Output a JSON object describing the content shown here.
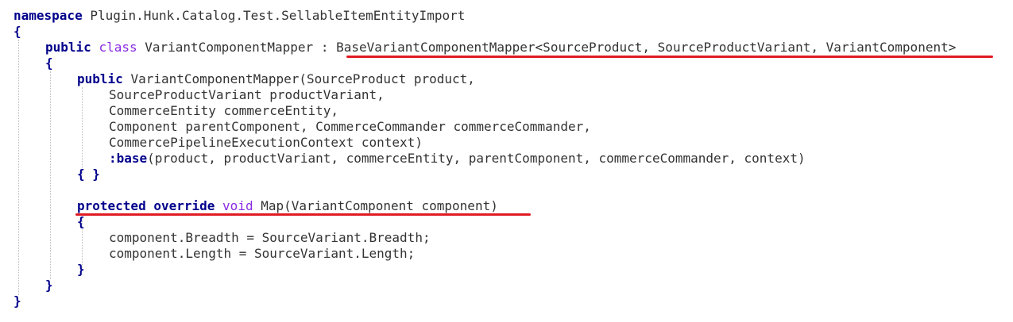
{
  "code": {
    "line1": {
      "kw": "namespace",
      "rest": "Plugin.Hunk.Catalog.Test.SellableItemEntityImport"
    },
    "line2": "{",
    "line3": {
      "kw_public": "public",
      "kw_class": "class",
      "name": "VariantComponentMapper",
      "colon": ":",
      "base": "BaseVariantComponentMapper<SourceProduct, SourceProductVariant, VariantComponent>"
    },
    "line4": "{",
    "line5": {
      "kw": "public",
      "rest": "VariantComponentMapper(SourceProduct product,"
    },
    "line6": "SourceProductVariant productVariant,",
    "line7": "CommerceEntity commerceEntity,",
    "line8": "Component parentComponent, CommerceCommander commerceCommander,",
    "line9": "CommercePipelineExecutionContext context)",
    "line10": {
      "kw": ":base",
      "rest": "(product, productVariant, commerceEntity, parentComponent, commerceCommander, context)"
    },
    "line11": "{ }",
    "line13": {
      "kw_protected": "protected",
      "kw_override": "override",
      "kw_void": "void",
      "rest": "Map(VariantComponent component)"
    },
    "line14": "{",
    "line15": "component.Breadth = SourceVariant.Breadth;",
    "line16": "component.Length = SourceVariant.Length;",
    "line17": "}",
    "line18": "}",
    "line19": "}"
  },
  "colors": {
    "keyword": "#0000ff",
    "keyword_bold": "#00008b",
    "void": "#8a2be2",
    "underline": "#e01b24"
  }
}
